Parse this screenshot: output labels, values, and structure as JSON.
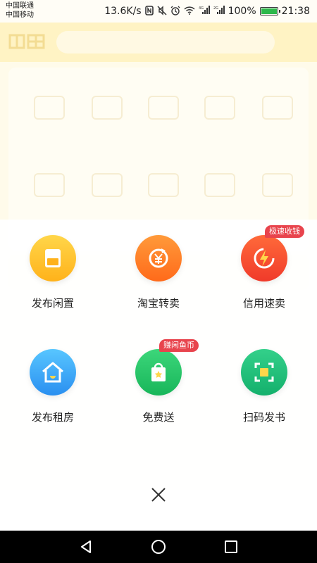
{
  "status_bar": {
    "carrier_1": "中国联通",
    "carrier_2": "中国移动",
    "net_speed": "13.6K/s",
    "battery_text": "100%",
    "battery_level": 1.0,
    "time": "21:38",
    "icons": [
      "nfc-icon",
      "mute-icon",
      "alarm-icon",
      "wifi-icon",
      "signal-4g-icon",
      "signal-2g-icon",
      "battery-icon"
    ]
  },
  "actions": [
    {
      "label": "发布闲置",
      "icon": "publish-idle-icon",
      "badge": ""
    },
    {
      "label": "淘宝转卖",
      "icon": "taobao-resell-icon",
      "badge": ""
    },
    {
      "label": "信用速卖",
      "icon": "credit-quick-sell-icon",
      "badge": "极速收钱"
    },
    {
      "label": "发布租房",
      "icon": "rent-house-icon",
      "badge": ""
    },
    {
      "label": "免费送",
      "icon": "free-giveaway-icon",
      "badge": "赚闲鱼币"
    },
    {
      "label": "扫码发书",
      "icon": "scan-book-icon",
      "badge": ""
    }
  ],
  "close_icon": "close-icon",
  "nav_bar": {
    "back_icon": "back-icon",
    "home_icon": "home-icon",
    "recents_icon": "recents-icon"
  },
  "colors": {
    "accent_yellow": "#ffd64a",
    "badge_red": "#e8444d",
    "overlay": "#ffffff"
  }
}
